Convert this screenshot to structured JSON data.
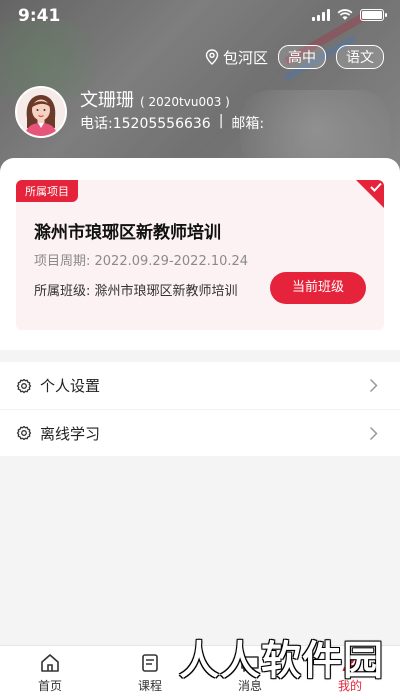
{
  "status_bar": {
    "time": "9:41"
  },
  "header": {
    "location": "包河区",
    "tags": [
      "高中",
      "语文"
    ]
  },
  "profile": {
    "name": "文珊珊",
    "id": "( 2020tvu003 )",
    "phone": "电话:15205556636",
    "separator": "|",
    "email": "邮箱:"
  },
  "project": {
    "badge": "所属项目",
    "title": "滁州市琅琊区新教师培训",
    "period": "项目周期:  2022.09.29-2022.10.24",
    "class": "所属班级:  滁州市琅琊区新教师培训",
    "current_button": "当前班级"
  },
  "menu": [
    {
      "label": "个人设置",
      "icon": "gear-icon"
    },
    {
      "label": "离线学习",
      "icon": "gear-icon"
    }
  ],
  "tabbar": [
    {
      "label": "首页",
      "icon": "home-icon",
      "active": false
    },
    {
      "label": "课程",
      "icon": "course-icon",
      "active": false
    },
    {
      "label": "消息",
      "icon": "message-icon",
      "active": false
    },
    {
      "label": "我的",
      "icon": "profile-icon",
      "active": true
    }
  ],
  "watermark": "人人软件园",
  "colors": {
    "accent": "#e5243b",
    "card_bg": "#fdf2f3"
  }
}
